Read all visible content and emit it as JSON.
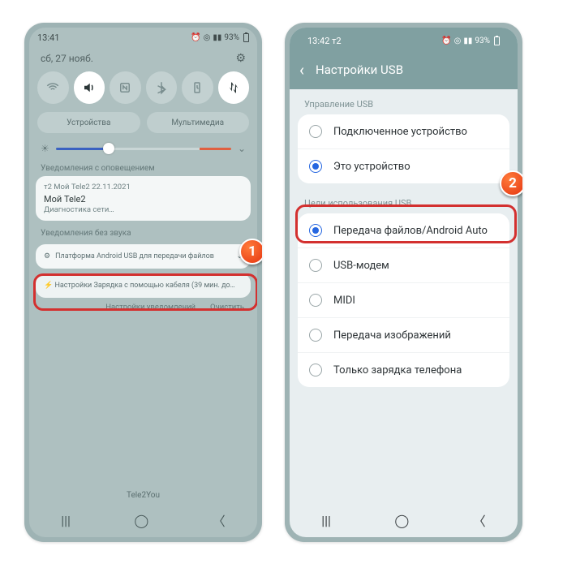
{
  "left": {
    "time": "13:41",
    "battery": "93%",
    "date": "сб, 27 нояб.",
    "pills": {
      "devices": "Устройства",
      "media": "Мультимедиа"
    },
    "section_alert": "Уведомления с оповещением",
    "notif1": {
      "app": "т2 Мой Tele2  22.11.2021",
      "title": "Мой Tele2",
      "body": "Диагностика сети…"
    },
    "section_silent": "Уведомления без звука",
    "sys1": "Платформа Android  USB для передачи файлов",
    "sys2": "Настройки  Зарядка с помощью кабеля (39 мин. до…",
    "footer": {
      "settings": "Настройки уведомлений",
      "clear": "Очистить"
    },
    "carrier": "Tele2You"
  },
  "right": {
    "time": "13:42  т2",
    "battery": "93%",
    "title": "Настройки USB",
    "group1": "Управление USB",
    "g1_items": [
      "Подключенное устройство",
      "Это устройство"
    ],
    "group2": "Цели использования USB",
    "g2_items": [
      "Передача файлов/Android Auto",
      "USB-модем",
      "MIDI",
      "Передача изображений",
      "Только зарядка телефона"
    ]
  },
  "badges": {
    "one": "1",
    "two": "2"
  }
}
